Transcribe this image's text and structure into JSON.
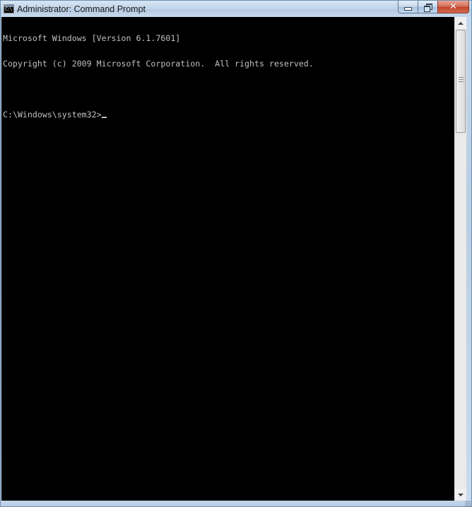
{
  "window": {
    "title": "Administrator: Command Prompt",
    "icon": "console-app-icon",
    "icon_glyph": "C:\\"
  },
  "caption_buttons": {
    "minimize_icon": "minimize-icon",
    "maximize_icon": "restore-icon",
    "close_icon": "close-icon",
    "close_glyph": "✕"
  },
  "console": {
    "lines": [
      "Microsoft Windows [Version 6.1.7601]",
      "Copyright (c) 2009 Microsoft Corporation.  All rights reserved.",
      "",
      "C:\\Windows\\system32>"
    ],
    "foreground": "#c0c0c0",
    "background": "#000000"
  },
  "scrollbar": {
    "up_icon": "scroll-up-arrow-icon",
    "down_icon": "scroll-down-arrow-icon"
  },
  "colors": {
    "close_button": "#c2452c",
    "titlebar": "#c2d6ea"
  }
}
